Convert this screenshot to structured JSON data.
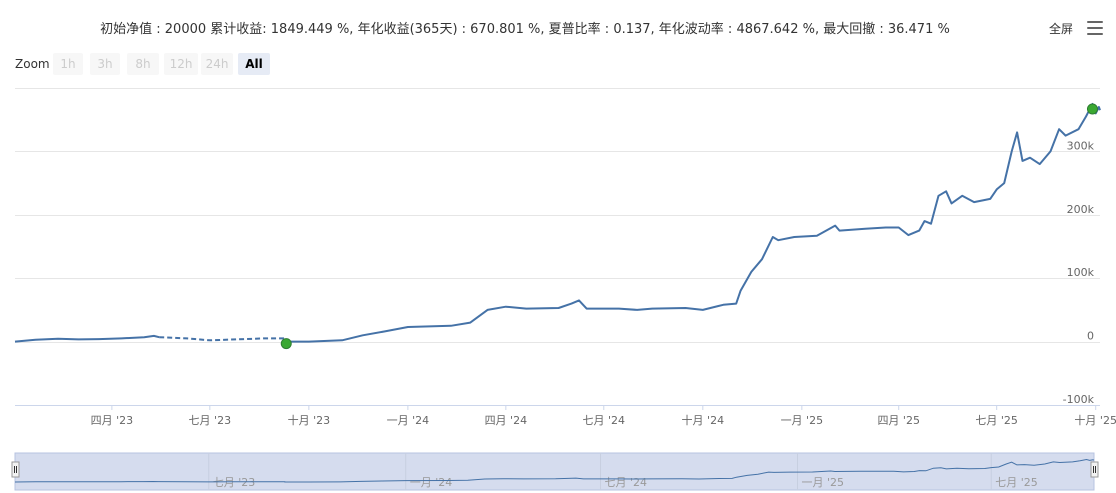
{
  "stats_text": "初始净值 : 20000 累计收益: 1849.449 %, 年化收益(365天) : 670.801 %, 夏普比率 : 0.137, 年化波动率 : 4867.642 %, 最大回撤 : 36.471 %",
  "toolbar": {
    "fullscreen_label": "全屏",
    "menu_icon": "hamburger-menu-icon"
  },
  "zoom": {
    "label": "Zoom",
    "buttons": [
      {
        "label": "1h",
        "active": false
      },
      {
        "label": "3h",
        "active": false
      },
      {
        "label": "8h",
        "active": false
      },
      {
        "label": "12h",
        "active": false
      },
      {
        "label": "24h",
        "active": false
      },
      {
        "label": "All",
        "active": true
      }
    ]
  },
  "colors": {
    "line": "#4572a7",
    "grid": "#e6e6e6",
    "navigator_fill": "#d5dcee",
    "marker": "#3aa832",
    "marker_dark": "#2e7d32"
  },
  "chart_data": {
    "type": "line",
    "title": "",
    "xlabel": "",
    "ylabel": "",
    "y_ticks": [
      -100000,
      0,
      100000,
      200000,
      300000
    ],
    "y_tick_labels": [
      "-100k",
      "0",
      "100k",
      "200k",
      "300k"
    ],
    "ylim": [
      -100000,
      400000
    ],
    "x_ticks": [
      "2023-04-01",
      "2023-07-01",
      "2023-10-01",
      "2024-01-01",
      "2024-04-01",
      "2024-07-01",
      "2024-10-01",
      "2025-01-01",
      "2025-04-01",
      "2025-07-01",
      "2025-10-01"
    ],
    "x_tick_labels": [
      "四月 '23",
      "七月 '23",
      "十月 '23",
      "一月 '24",
      "四月 '24",
      "七月 '24",
      "十月 '24",
      "一月 '25",
      "四月 '25",
      "七月 '25",
      "十月 '25"
    ],
    "xlim": [
      "2023-01-01",
      "2025-10-05"
    ],
    "grid": true,
    "legend": "none",
    "series": [
      {
        "segments": [
          {
            "style": "solid",
            "points": [
              [
                "2023-01-01",
                0
              ],
              [
                "2023-01-20",
                3000
              ],
              [
                "2023-02-10",
                4500
              ],
              [
                "2023-03-01",
                3500
              ],
              [
                "2023-03-20",
                4000
              ],
              [
                "2023-04-10",
                5000
              ],
              [
                "2023-05-01",
                7000
              ],
              [
                "2023-05-10",
                9000
              ],
              [
                "2023-05-15",
                7000
              ]
            ]
          },
          {
            "style": "dashed",
            "points": [
              [
                "2023-05-15",
                7000
              ],
              [
                "2023-06-10",
                5000
              ],
              [
                "2023-07-01",
                2000
              ],
              [
                "2023-07-25",
                3500
              ],
              [
                "2023-08-20",
                5000
              ],
              [
                "2023-09-10",
                5000
              ]
            ]
          },
          {
            "style": "solid",
            "points": [
              [
                "2023-09-10",
                0
              ],
              [
                "2023-10-01",
                0
              ],
              [
                "2023-11-01",
                2000
              ],
              [
                "2023-11-20",
                10000
              ],
              [
                "2023-12-10",
                16000
              ],
              [
                "2024-01-01",
                23000
              ],
              [
                "2024-02-10",
                25000
              ],
              [
                "2024-02-28",
                30000
              ],
              [
                "2024-03-15",
                50000
              ],
              [
                "2024-04-01",
                55000
              ],
              [
                "2024-04-20",
                52000
              ],
              [
                "2024-05-20",
                53000
              ],
              [
                "2024-06-01",
                60000
              ],
              [
                "2024-06-08",
                65000
              ],
              [
                "2024-06-15",
                52000
              ],
              [
                "2024-07-15",
                52000
              ],
              [
                "2024-08-01",
                50000
              ],
              [
                "2024-08-15",
                52000
              ],
              [
                "2024-09-15",
                53000
              ],
              [
                "2024-10-01",
                50000
              ],
              [
                "2024-10-15",
                56000
              ],
              [
                "2024-10-20",
                58000
              ],
              [
                "2024-11-01",
                60000
              ],
              [
                "2024-11-05",
                80000
              ],
              [
                "2024-11-15",
                110000
              ],
              [
                "2024-11-25",
                130000
              ],
              [
                "2024-12-05",
                165000
              ],
              [
                "2024-12-10",
                160000
              ],
              [
                "2024-12-25",
                165000
              ],
              [
                "2025-01-15",
                167000
              ],
              [
                "2025-02-01",
                183000
              ],
              [
                "2025-02-05",
                175000
              ],
              [
                "2025-03-01",
                178000
              ],
              [
                "2025-03-20",
                180000
              ],
              [
                "2025-04-01",
                180000
              ],
              [
                "2025-04-10",
                168000
              ],
              [
                "2025-04-20",
                175000
              ],
              [
                "2025-04-25",
                190000
              ],
              [
                "2025-05-01",
                186000
              ],
              [
                "2025-05-08",
                230000
              ],
              [
                "2025-05-15",
                237000
              ],
              [
                "2025-05-20",
                218000
              ],
              [
                "2025-05-30",
                230000
              ],
              [
                "2025-06-10",
                220000
              ],
              [
                "2025-06-25",
                225000
              ],
              [
                "2025-07-01",
                240000
              ],
              [
                "2025-07-08",
                250000
              ],
              [
                "2025-07-15",
                300000
              ],
              [
                "2025-07-20",
                330000
              ],
              [
                "2025-07-25",
                285000
              ],
              [
                "2025-08-01",
                290000
              ],
              [
                "2025-08-10",
                280000
              ],
              [
                "2025-08-20",
                300000
              ],
              [
                "2025-08-28",
                335000
              ],
              [
                "2025-09-03",
                325000
              ],
              [
                "2025-09-15",
                335000
              ],
              [
                "2025-09-22",
                355000
              ],
              [
                "2025-09-28",
                375000
              ],
              [
                "2025-10-01",
                360000
              ],
              [
                "2025-10-04",
                370000
              ],
              [
                "2025-10-05",
                365000
              ]
            ]
          }
        ]
      }
    ],
    "flags": [
      {
        "x": "2023-09-10",
        "y": 0,
        "label": ""
      },
      {
        "x": "2025-09-28",
        "y": 370000,
        "label": ""
      }
    ],
    "navigator": {
      "tick_labels": [
        "七月 '23",
        "一月 '24",
        "七月 '24",
        "一月 '25",
        "七月 '25"
      ],
      "ticks": [
        "2023-07-01",
        "2024-01-01",
        "2024-07-01",
        "2025-01-01",
        "2025-07-01"
      ]
    }
  }
}
